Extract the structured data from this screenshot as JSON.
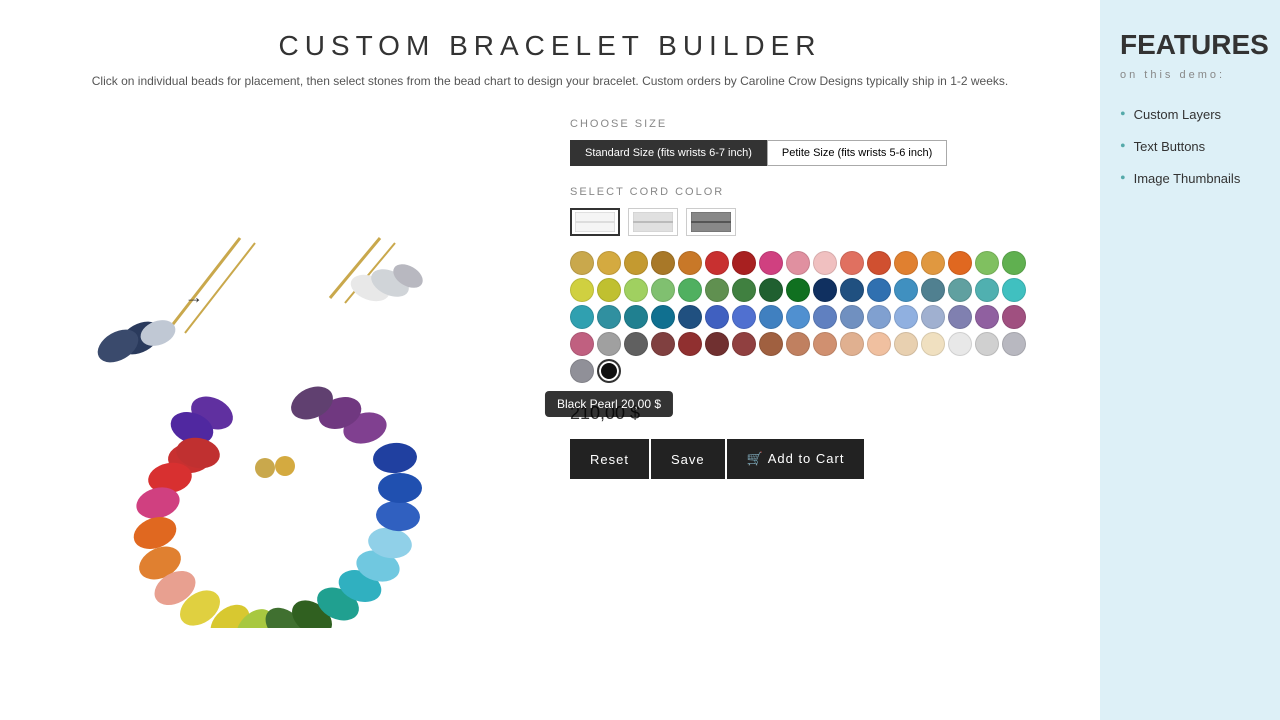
{
  "page": {
    "title": "CUSTOM BRACELET BUILDER",
    "subtitle": "Click on individual beads for placement, then select stones from the bead chart to design your bracelet. Custom orders by Caroline Crow Designs typically ship in 1-2 weeks."
  },
  "size_section": {
    "label": "CHOOSE SIZE",
    "options": [
      {
        "id": "standard",
        "label": "Standard Size (fits wrists 6-7 inch)",
        "active": true
      },
      {
        "id": "petite",
        "label": "Petite Size (fits wrists 5-6 inch)",
        "active": false
      }
    ]
  },
  "cord_section": {
    "label": "SELECT CORD COLOR"
  },
  "price": "210,00 $",
  "buttons": {
    "reset": "Reset",
    "save": "Save",
    "add_to_cart": "Add to Cart"
  },
  "tooltip": {
    "text": "Black Pearl 20,00 $"
  },
  "features": {
    "title": "FEATURES",
    "subtitle": "on this demo:",
    "items": [
      {
        "label": "Custom Layers"
      },
      {
        "label": "Text Buttons"
      },
      {
        "label": "Image Thumbnails"
      }
    ]
  },
  "colors": [
    [
      "#c9a84c",
      "#d4aa40",
      "#c49a30",
      "#a87828",
      "#c87828",
      "#c83030",
      "#a82020",
      "#d04080",
      "#e090a0",
      "#f0c0c0",
      "#e07060",
      "#d05030",
      "#e08030"
    ],
    [
      "#e09840",
      "#e06820",
      "#80c060",
      "#60b050",
      "#d0d040",
      "#c0c030",
      "#a0d060",
      "#80c070",
      "#50b060",
      "#609050",
      "#408040",
      "#206030",
      "#107020"
    ],
    [
      "#103060",
      "#205080",
      "#3070b0",
      "#4090c0",
      "#508090",
      "#60a0a0",
      "#50b0b0",
      "#40c0c0",
      "#30a0b0",
      "#3090a0",
      "#208090",
      "#107090",
      "#205080",
      "#304090"
    ],
    [
      "#4060c0",
      "#5070d0",
      "#4080c0",
      "#5090d0",
      "#6080c0",
      "#7090c0",
      "#80a0d0",
      "#90b0e0",
      "#a0b0d0",
      "#8080b0",
      "#9060a0",
      "#a05080",
      "#c06080",
      "#d080a0",
      "#c090b0"
    ],
    [
      "#a0a0a0",
      "#606060",
      "#804040",
      "#903030",
      "#703030",
      "#904040",
      "#a06040",
      "#c08060",
      "#d09070",
      "#e0b090",
      "#f0c0a0",
      "#e8d0b0",
      "#f0e0c0",
      "#d0d0d0"
    ],
    [
      "#d8d8d8",
      "#c0c0c0",
      "#a8a8b8",
      "#909098",
      "#101010",
      "#",
      "",
      "",
      "",
      "",
      "",
      "",
      "",
      "",
      "",
      "",
      ""
    ]
  ]
}
